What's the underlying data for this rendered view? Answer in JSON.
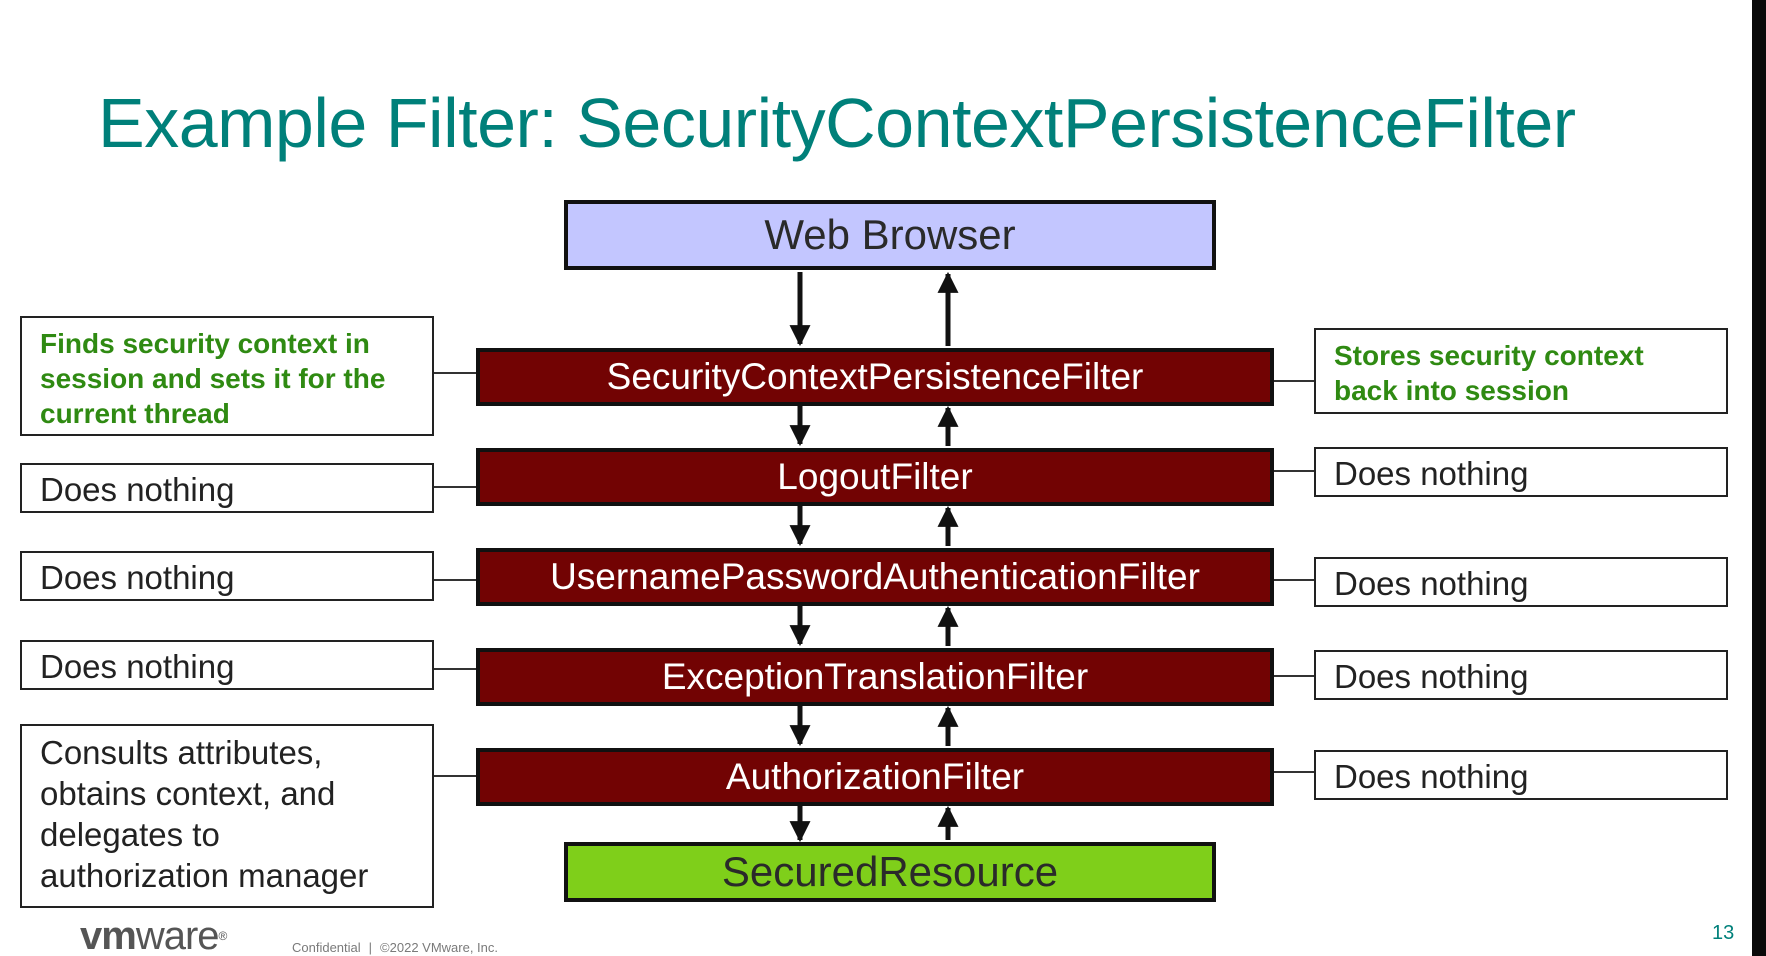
{
  "title": "Example Filter: SecurityContextPersistenceFilter",
  "web_browser": "Web Browser",
  "secured_resource": "SecuredResource",
  "filters": [
    "SecurityContextPersistenceFilter",
    "LogoutFilter",
    "UsernamePasswordAuthenticationFilter",
    "ExceptionTranslationFilter",
    "AuthorizationFilter"
  ],
  "left_notes": [
    [
      "Finds security context in",
      "session and sets it for the",
      "current thread"
    ],
    [
      "Does nothing"
    ],
    [
      "Does nothing"
    ],
    [
      "Does nothing"
    ],
    [
      "Consults attributes,",
      "obtains context, and",
      "delegates to",
      "authorization manager"
    ]
  ],
  "right_notes": [
    [
      "Stores security context",
      "back into session"
    ],
    [
      "Does nothing"
    ],
    [
      "Does nothing"
    ],
    [
      "Does nothing"
    ],
    [
      "Does nothing"
    ]
  ],
  "footer": {
    "logo_vm": "vm",
    "logo_ware": "ware",
    "logo_mark": "®",
    "confidential": "Confidential",
    "separator": "|",
    "copyright": "©2022 VMware, Inc.",
    "page_number": "13"
  },
  "colors": {
    "title": "#00807a",
    "browser_fill": "#c3c6ff",
    "filter_fill": "#720303",
    "resource_fill": "#7fcf1a",
    "green_note_text": "#2f8a12"
  }
}
